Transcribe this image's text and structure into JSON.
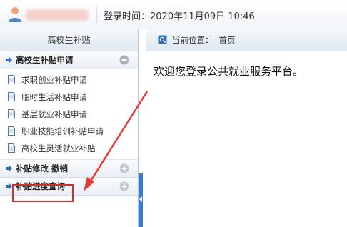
{
  "header": {
    "login_time_label": "登录时间：",
    "login_time_value": "2020年11月09日 10:46"
  },
  "sidebar": {
    "title": "高校生补贴",
    "sections": [
      {
        "label": "高校生补贴申请",
        "toggle": "collapse",
        "items": [
          {
            "label": "求职创业补贴申请"
          },
          {
            "label": "临时生活补贴申请"
          },
          {
            "label": "基层就业补贴申请"
          },
          {
            "label": "职业技能培训补贴申请"
          },
          {
            "label": "高校生灵活就业补贴"
          }
        ]
      },
      {
        "label": "补贴修改 撤销",
        "toggle": "expand"
      },
      {
        "label": "补贴进度查询",
        "toggle": "expand"
      }
    ]
  },
  "main": {
    "breadcrumb_label": "当前位置：",
    "breadcrumb_page": "首页",
    "welcome": "欢迎您登录公共就业服务平台。"
  },
  "colors": {
    "accent": "#3b7cc4",
    "highlight": "#d32f2f",
    "arrow": "#e53935"
  }
}
